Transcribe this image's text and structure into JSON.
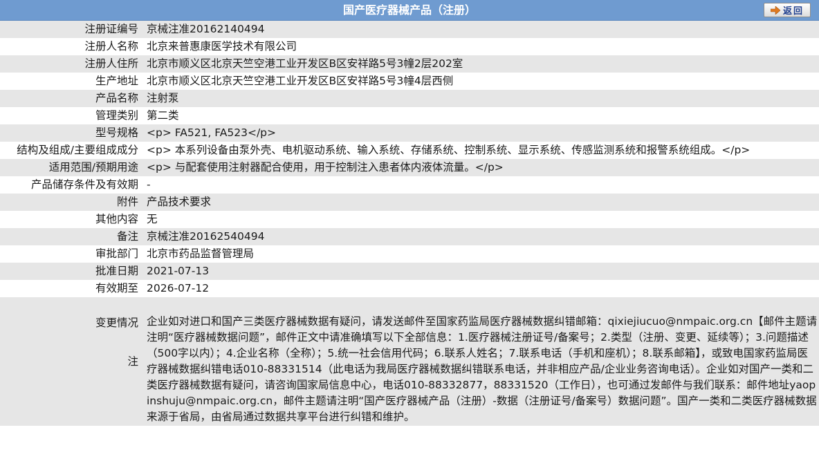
{
  "header": {
    "title": "国产医疗器械产品（注册）",
    "back_label": "返回"
  },
  "rows": [
    {
      "label": "注册证编号",
      "value": "京械注准20162140494"
    },
    {
      "label": "注册人名称",
      "value": "北京来普惠康医学技术有限公司"
    },
    {
      "label": "注册人住所",
      "value": "北京市顺义区北京天竺空港工业开发区B区安祥路5号3幢2层202室"
    },
    {
      "label": "生产地址",
      "value": "北京市顺义区北京天竺空港工业开发区B区安祥路5号3幢4层西侧"
    },
    {
      "label": "产品名称",
      "value": "注射泵"
    },
    {
      "label": "管理类别",
      "value": "第二类"
    },
    {
      "label": "型号规格",
      "value": "<p> FA521, FA523</p>"
    },
    {
      "label": "结构及组成/主要组成成分",
      "value": "<p> 本系列设备由泵外壳、电机驱动系统、输入系统、存储系统、控制系统、显示系统、传感监测系统和报警系统组成。</p>"
    },
    {
      "label": "适用范围/预期用途",
      "value": "<p> 与配套使用注射器配合使用，用于控制注入患者体内液体流量。</p>"
    },
    {
      "label": "产品储存条件及有效期",
      "value": "-"
    },
    {
      "label": "附件",
      "value": "产品技术要求"
    },
    {
      "label": "其他内容",
      "value": "无"
    },
    {
      "label": "备注",
      "value": "京械注准20162540494"
    },
    {
      "label": "审批部门",
      "value": "北京市药品监督管理局"
    },
    {
      "label": "批准日期",
      "value": "2021-07-13"
    },
    {
      "label": "有效期至",
      "value": "2026-07-12"
    },
    {
      "label": "变更情况",
      "value": ""
    }
  ],
  "note": {
    "label": "注",
    "text": "企业如对进口和国产三类医疗器械数据有疑问，请发送邮件至国家药监局医疗器械数据纠错邮箱：qixiejiucuo@nmpaic.org.cn【邮件主题请注明“医疗器械数据问题”，邮件正文中请准确填写以下全部信息：1.医疗器械注册证号/备案号；2.类型（注册、变更、延续等）；3.问题描述（500字以内）；4.企业名称（全称）；5.统一社会信用代码；6.联系人姓名；7.联系电话（手机和座机）；8.联系邮箱】，或致电国家药监局医疗器械数据纠错电话010-88331514（此电话为我局医疗器械数据纠错联系电话，并非相应产品/企业业务咨询电话）。企业如对国产一类和二类医疗器械数据有疑问，请咨询国家局信息中心，电话010-88332877，88331520（工作日），也可通过发邮件与我们联系：邮件地址yaopinshuju@nmpaic.org.cn，邮件主题请注明“国产医疗器械产品（注册）-数据（注册证号/备案号）数据问题”。国产一类和二类医疗器械数据来源于省局，由省局通过数据共享平台进行纠错和维护。"
  },
  "colors": {
    "header_bg": "#6f9bd0",
    "row_alt_bg": "#e6e6e6",
    "back_arrow": "#e07a1f"
  },
  "icons": {
    "back": "arrow-right-icon"
  }
}
